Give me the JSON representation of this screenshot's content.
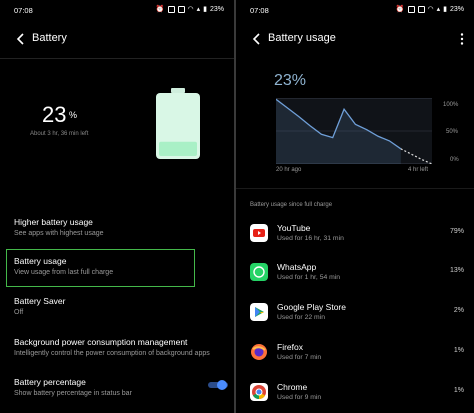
{
  "colors": {
    "accent_green": "#44b84a",
    "toggle_blue": "#4a8cff",
    "chart_line": "#6f9fd8",
    "battery_fill": "#a9f0c6"
  },
  "status": {
    "time": "07:08",
    "battery": "23%",
    "net": "0.00 KB/S",
    "signal": "4G"
  },
  "left": {
    "title": "Battery",
    "percent": "23",
    "percent_sign": "%",
    "time_left": "About 3 hr, 36 min left",
    "battery_level": 0.23,
    "items": [
      {
        "title": "Higher battery usage",
        "sub": "See apps with highest usage"
      },
      {
        "title": "Battery usage",
        "sub": "View usage from last full charge"
      },
      {
        "title": "Battery Saver",
        "sub": "Off"
      },
      {
        "title": "Background power consumption management",
        "sub": "Intelligently control the power consumption of background apps"
      },
      {
        "title": "Battery percentage",
        "sub": "Show battery percentage in status bar"
      }
    ],
    "battery_percentage_toggle": true
  },
  "right": {
    "title": "Battery usage",
    "percent": "23%",
    "y_labels": [
      "100%",
      "50%",
      "0%"
    ],
    "x_labels": [
      "20 hr ago",
      "4 hr left"
    ],
    "since": "Battery usage since full charge",
    "apps": [
      {
        "name": "YouTube",
        "use": "Used for 16 hr, 31 min",
        "pct": "79%",
        "icon": "youtube-icon"
      },
      {
        "name": "WhatsApp",
        "use": "Used for 1 hr, 54 min",
        "pct": "13%",
        "icon": "whatsapp-icon"
      },
      {
        "name": "Google Play Store",
        "use": "Used for 22 min",
        "pct": "2%",
        "icon": "play-store-icon"
      },
      {
        "name": "Firefox",
        "use": "Used for 7 min",
        "pct": "1%",
        "icon": "firefox-icon"
      },
      {
        "name": "Chrome",
        "use": "Used for 9 min",
        "pct": "1%",
        "icon": "chrome-icon"
      }
    ]
  },
  "chart_data": {
    "type": "line",
    "x_labels": [
      "20 hr ago",
      "4 hr left"
    ],
    "ylim": [
      0,
      100
    ],
    "y_ticks": [
      "100%",
      "50%",
      "0%"
    ],
    "series": [
      {
        "values": [
          98,
          85,
          72,
          58,
          45,
          40,
          83,
          60,
          52,
          42,
          35,
          23
        ]
      },
      {
        "values": [
          23,
          15,
          7,
          0
        ]
      }
    ]
  }
}
